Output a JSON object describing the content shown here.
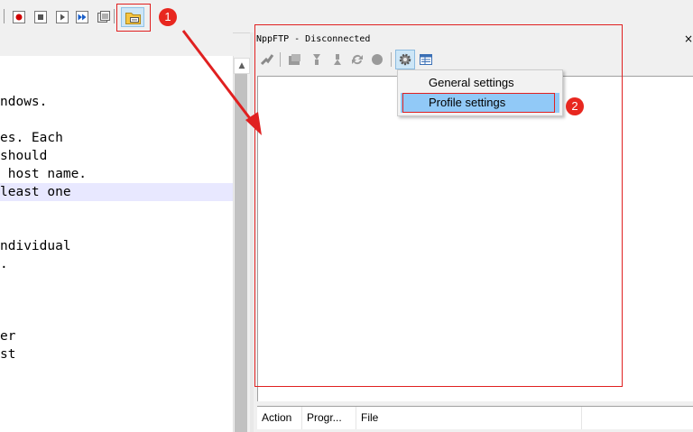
{
  "panel": {
    "title": "NppFTP - Disconnected",
    "close_glyph": "×"
  },
  "menu": {
    "items": [
      {
        "label": "General settings",
        "highlighted": false
      },
      {
        "label": "Profile settings",
        "highlighted": true
      }
    ]
  },
  "queue": {
    "columns": [
      "Action",
      "Progr...",
      "File"
    ]
  },
  "editor": {
    "lines": [
      "ndows.",
      "",
      "es. Each",
      "should",
      " host name.",
      "least one",
      "",
      "",
      "ndividual",
      ".",
      "",
      "",
      "",
      "er",
      "st"
    ],
    "current_line_index": 5,
    "scroll_up_glyph": "▲"
  },
  "annotations": {
    "badge1": "1",
    "badge2": "2",
    "color": "#e02020"
  },
  "icons": {
    "toolbar": [
      "record-macro-icon",
      "stop-macro-icon",
      "play-macro-icon",
      "run-macro-multiple-icon",
      "save-macro-icon",
      "nppftp-show-icon"
    ],
    "panel_toolbar": [
      "connect-icon",
      "open-dir-icon",
      "download-icon",
      "upload-icon",
      "refresh-icon",
      "abort-icon",
      "settings-gear-icon",
      "message-window-icon"
    ]
  }
}
